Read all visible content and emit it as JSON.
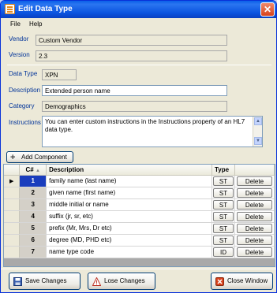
{
  "window": {
    "title": "Edit Data Type"
  },
  "menu": {
    "file": "File",
    "help": "Help"
  },
  "form": {
    "vendor_label": "Vendor",
    "vendor_value": "Custom Vendor",
    "version_label": "Version",
    "version_value": "2.3",
    "datatype_label": "Data Type",
    "datatype_value": "XPN",
    "description_label": "Description",
    "description_value": "Extended person name",
    "category_label": "Category",
    "category_value": "Demographics",
    "instructions_label": "Instructions",
    "instructions_value": "You can enter custom instructions in the Instructions property of an HL7 data type."
  },
  "add_component_label": "Add Component",
  "grid": {
    "headers": {
      "cnum": "C#",
      "description": "Description",
      "type": "Type"
    },
    "delete_label": "Delete",
    "rows": [
      {
        "num": "1",
        "description": "family name (last name)",
        "type": "ST"
      },
      {
        "num": "2",
        "description": "given name (first name)",
        "type": "ST"
      },
      {
        "num": "3",
        "description": "middle initial or name",
        "type": "ST"
      },
      {
        "num": "4",
        "description": "suffix (jr, sr, etc)",
        "type": "ST"
      },
      {
        "num": "5",
        "description": "prefix (Mr, Mrs, Dr etc)",
        "type": "ST"
      },
      {
        "num": "6",
        "description": "degree (MD, PHD etc)",
        "type": "ST"
      },
      {
        "num": "7",
        "description": "name type code",
        "type": "ID"
      }
    ]
  },
  "buttons": {
    "save": "Save Changes",
    "lose": "Lose Changes",
    "close": "Close Window"
  },
  "colors": {
    "accent": "#0a5fe8",
    "selected_row": "#1a3dbd"
  }
}
